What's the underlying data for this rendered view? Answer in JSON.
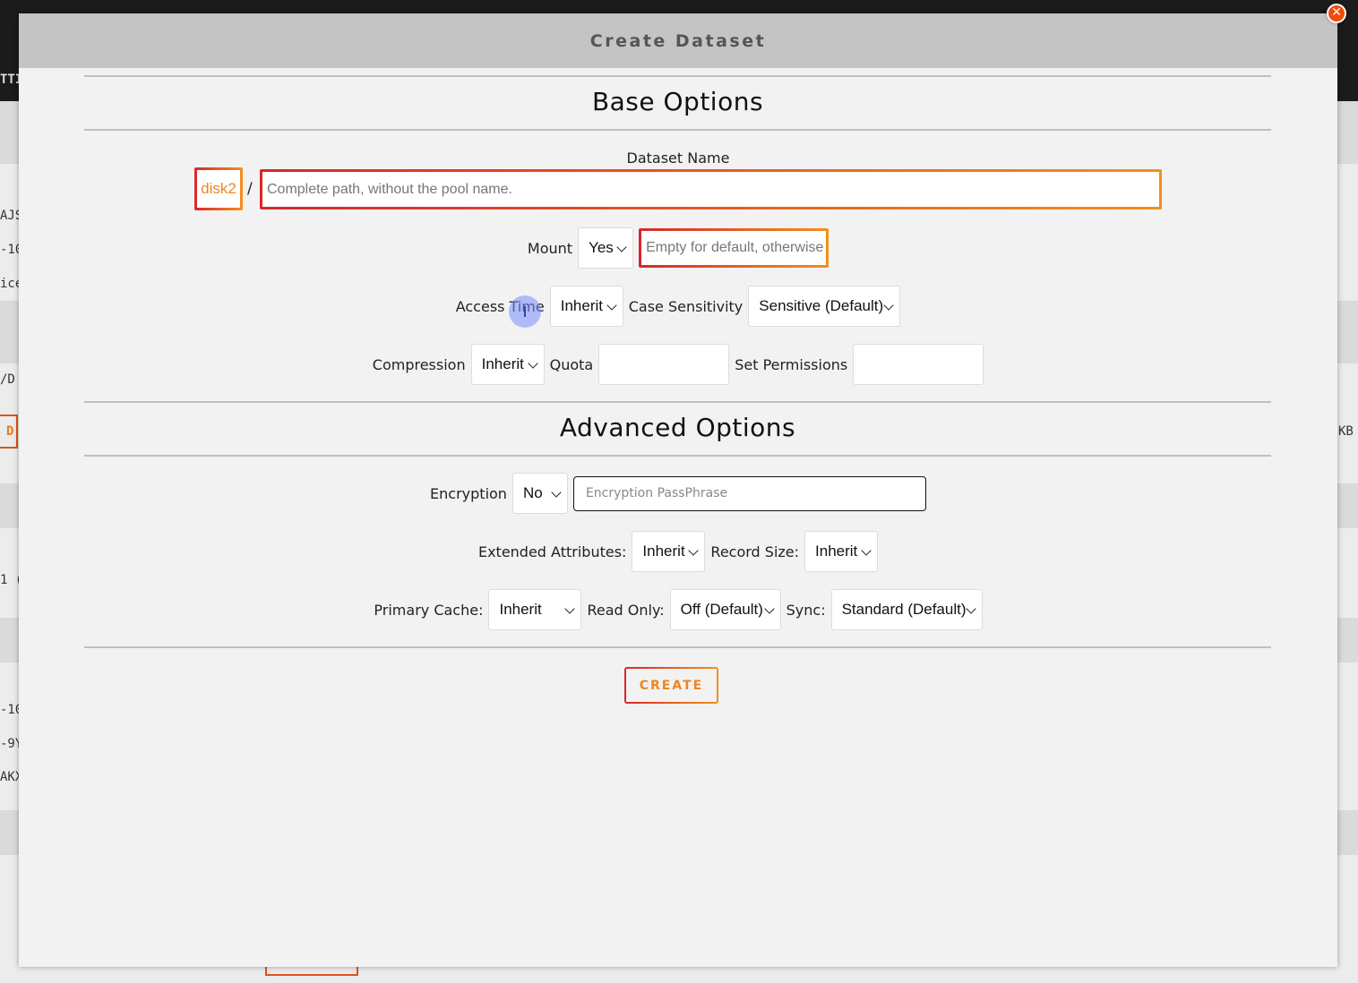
{
  "background": {
    "fragments": [
      "TTI",
      "AJS",
      "-10",
      "ice",
      "/D",
      "D",
      "KB",
      "1 (",
      "-10",
      "-9Y",
      "AKX"
    ]
  },
  "modal": {
    "title": "Create Dataset",
    "close_glyph": "✕"
  },
  "base_options": {
    "heading": "Base Options",
    "dataset_name_label": "Dataset Name",
    "pool_name": "disk2",
    "path_separator": "/",
    "path_placeholder": "Complete path, without the pool name.",
    "mount_label": "Mount",
    "mount_value": "Yes",
    "mountpoint_placeholder": "Empty for default, otherwise",
    "access_time_label": "Access Time",
    "access_time_value": "Inherit",
    "case_sensitivity_label": "Case Sensitivity",
    "case_sensitivity_value": "Sensitive (Default)",
    "compression_label": "Compression",
    "compression_value": "Inherit",
    "quota_label": "Quota",
    "quota_value": "",
    "set_permissions_label": "Set Permissions",
    "set_permissions_value": ""
  },
  "advanced_options": {
    "heading": "Advanced Options",
    "encryption_label": "Encryption",
    "encryption_value": "No",
    "passphrase_placeholder": "Encryption PassPhrase",
    "extended_attributes_label": "Extended Attributes:",
    "extended_attributes_value": "Inherit",
    "record_size_label": "Record Size:",
    "record_size_value": "Inherit",
    "primary_cache_label": "Primary Cache:",
    "primary_cache_value": "Inherit",
    "read_only_label": "Read Only:",
    "read_only_value": "Off (Default)",
    "sync_label": "Sync:",
    "sync_value": "Standard (Default)"
  },
  "actions": {
    "create_label": "CREATE"
  },
  "colors": {
    "accent_orange": "#f0861c",
    "accent_red": "#d8262a",
    "close_button": "#f04a0c"
  }
}
